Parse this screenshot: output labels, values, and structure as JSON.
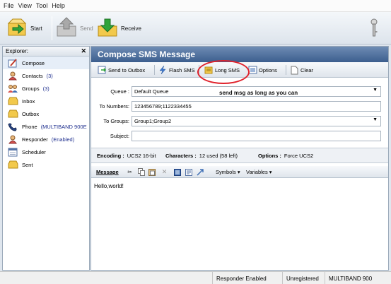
{
  "menu": [
    "File",
    "View",
    "Tool",
    "Help"
  ],
  "toolbar": {
    "start": "Start",
    "send": "Send",
    "receive": "Receive"
  },
  "explorer": {
    "title": "Explorer:",
    "items": [
      {
        "label": "Compose",
        "count": ""
      },
      {
        "label": "Contacts",
        "count": "(3)"
      },
      {
        "label": "Groups",
        "count": "(3)"
      },
      {
        "label": "Inbox",
        "count": ""
      },
      {
        "label": "Outbox",
        "count": ""
      },
      {
        "label": "Phone",
        "count": "(MULTIBAND  900E"
      },
      {
        "label": "Responder",
        "count": "(Enabled)"
      },
      {
        "label": "Scheduler",
        "count": ""
      },
      {
        "label": "Sent",
        "count": ""
      }
    ]
  },
  "compose": {
    "title": "Compose SMS Message",
    "buttons": {
      "outbox": "Send to Outbox",
      "flash": "Flash SMS",
      "long": "Long SMS",
      "options": "Options",
      "clear": "Clear"
    },
    "queue_label": "Queue :",
    "queue_value": "Default Queue",
    "numbers_label": "To Numbers:",
    "numbers_value": "123456789;1122334455",
    "groups_label": "To Groups:",
    "groups_value": "Group1;Group2",
    "subject_label": "Subject:",
    "subject_value": "",
    "annotation": "send msg as long as you can"
  },
  "info": {
    "encoding_label": "Encoding :",
    "encoding_value": "UCS2 16-bit",
    "characters_label": "Characters :",
    "characters_value": "12 used (58 left)",
    "options_label": "Options :",
    "options_value": "Force UCS2"
  },
  "message": {
    "label": "Message",
    "symbols": "Symbols",
    "variables": "Variables",
    "text": "Hello,world!"
  },
  "status": {
    "responder": "Responder Enabled",
    "registration": "Unregistered",
    "network": "MULTIBAND  900"
  },
  "colors": {
    "title_bar": "#4a6a98",
    "highlight_oval": "#e0212b",
    "count_text": "#20308f"
  }
}
